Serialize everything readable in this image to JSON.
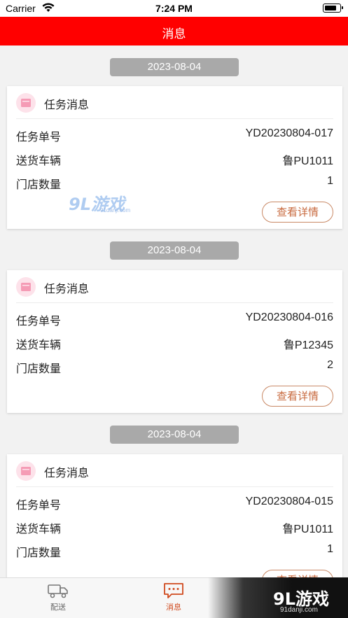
{
  "status_bar": {
    "carrier": "Carrier",
    "time": "7:24 PM"
  },
  "nav": {
    "title": "消息"
  },
  "messages": [
    {
      "date": "2023-08-04",
      "title": "任务消息",
      "rows": [
        {
          "label": "任务单号",
          "value": "YD20230804-017"
        },
        {
          "label": "送货车辆",
          "value": "鲁PU1011"
        },
        {
          "label": "门店数量",
          "value": "1"
        }
      ],
      "detail_button": "查看详情"
    },
    {
      "date": "2023-08-04",
      "title": "任务消息",
      "rows": [
        {
          "label": "任务单号",
          "value": "YD20230804-016"
        },
        {
          "label": "送货车辆",
          "value": "鲁P12345"
        },
        {
          "label": "门店数量",
          "value": "2"
        }
      ],
      "detail_button": "查看详情"
    },
    {
      "date": "2023-08-04",
      "title": "任务消息",
      "rows": [
        {
          "label": "任务单号",
          "value": "YD20230804-015"
        },
        {
          "label": "送货车辆",
          "value": "鲁PU1011"
        },
        {
          "label": "门店数量",
          "value": "1"
        }
      ],
      "detail_button": "查看详情"
    }
  ],
  "tabbar": {
    "tabs": [
      {
        "label": "配送",
        "icon": "truck-icon",
        "active": false
      },
      {
        "label": "消息",
        "icon": "chat-bubble-icon",
        "active": true
      }
    ]
  },
  "watermark": {
    "logo_text": "9L游戏",
    "site": "91danji.com",
    "mid_logo": "9L游戏",
    "mid_site": "91danji.com"
  },
  "colors": {
    "nav_bg": "#ff0000",
    "accent": "#c86a3f",
    "date_pill": "#a9a9a9",
    "active_tab": "#d04a1e"
  }
}
